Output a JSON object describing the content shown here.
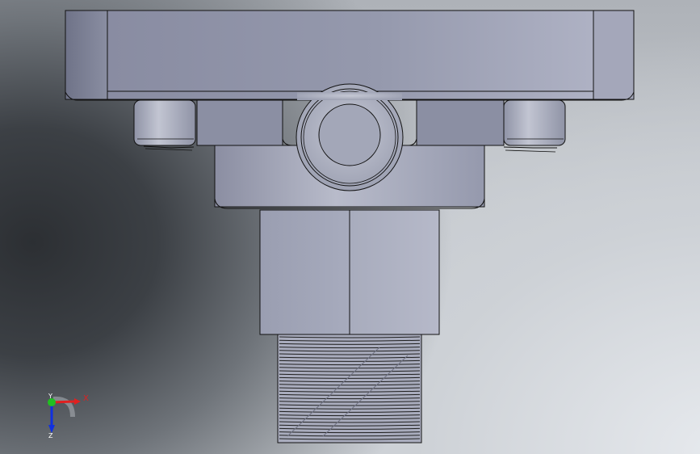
{
  "triad": {
    "x_label": "X",
    "y_label": "Y",
    "z_label": "Z",
    "colors": {
      "x": "#e02020",
      "y": "#20c020",
      "z": "#1030e0"
    }
  },
  "model": {
    "colors": {
      "face_light": "#b9bcca",
      "face_mid": "#9a9eb0",
      "face_dark": "#7d8193",
      "edge": "#121212"
    }
  }
}
